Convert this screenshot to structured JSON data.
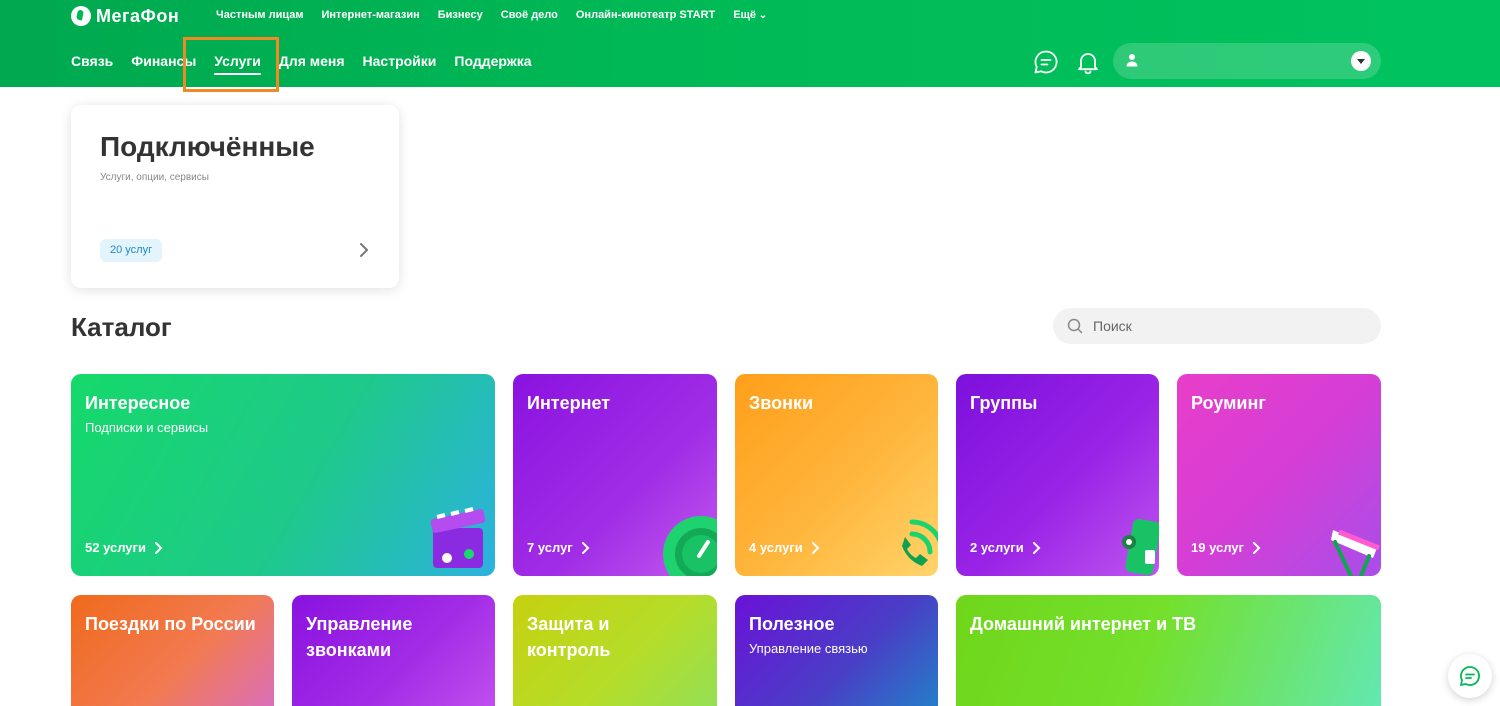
{
  "brand": {
    "name": "МегаФон"
  },
  "top_nav": [
    "Частным лицам",
    "Интернет-магазин",
    "Бизнесу",
    "Своё дело",
    "Онлайн-кинотеатр START",
    "Ещё"
  ],
  "main_nav": [
    {
      "label": "Связь"
    },
    {
      "label": "Финансы"
    },
    {
      "label": "Услуги",
      "active": true
    },
    {
      "label": "Для меня"
    },
    {
      "label": "Настройки"
    },
    {
      "label": "Поддержка"
    }
  ],
  "header_icons": [
    "chat-icon",
    "bell-icon",
    "user-icon",
    "chevron-down-icon"
  ],
  "connected": {
    "title": "Подключённые",
    "subtitle": "Услуги, опции, сервисы",
    "badge": "20 услуг"
  },
  "catalog": {
    "title": "Каталог",
    "search_placeholder": "Поиск",
    "tiles": [
      {
        "title": "Интересное",
        "subtitle": "Подписки и сервисы",
        "count": "52 услуги"
      },
      {
        "title": "Интернет",
        "subtitle": "",
        "count": "7 услуг"
      },
      {
        "title": "Звонки",
        "subtitle": "",
        "count": "4 услуги"
      },
      {
        "title": "Группы",
        "subtitle": "",
        "count": "2 услуги"
      },
      {
        "title": "Роуминг",
        "subtitle": "",
        "count": "19 услуг"
      },
      {
        "title": "Поездки по России",
        "subtitle": "",
        "count": ""
      },
      {
        "title": "Управление звонками",
        "subtitle": "",
        "count": ""
      },
      {
        "title": "Защита и контроль",
        "subtitle": "",
        "count": ""
      },
      {
        "title": "Полезное",
        "subtitle": "Управление связью",
        "count": ""
      },
      {
        "title": "Домашний интернет и ТВ",
        "subtitle": "",
        "count": ""
      }
    ]
  },
  "colors": {
    "brand_green": "#00b956",
    "highlight": "#f08a24",
    "badge_text": "#1e88c9"
  }
}
